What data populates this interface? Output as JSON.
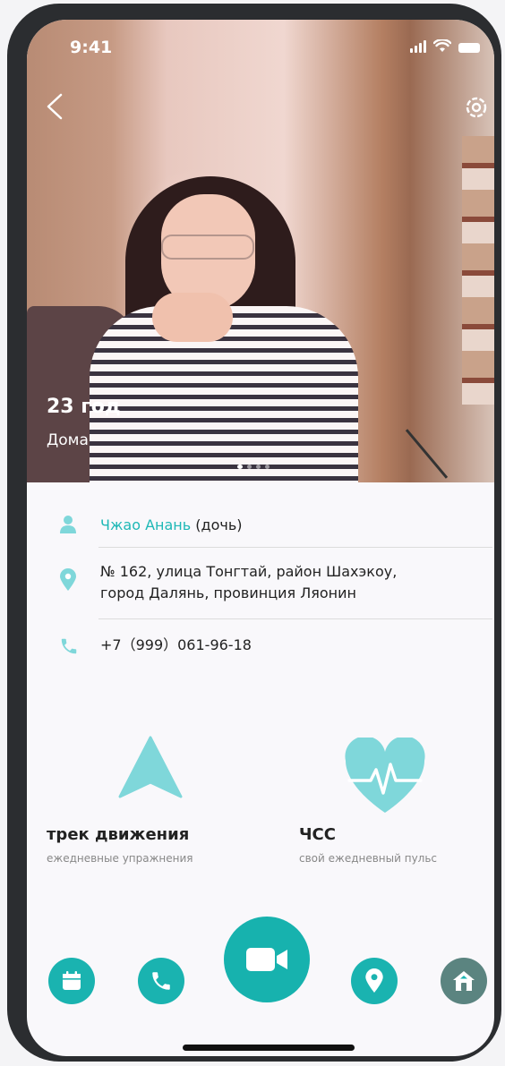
{
  "status_bar": {
    "time": "9:41"
  },
  "profile": {
    "age": "23 год",
    "status": "Дома"
  },
  "contact": {
    "name": "Чжао Анань",
    "relation": "(дочь)",
    "address_line1": "№ 162, улица Тонгтай, район Шахэкоу,",
    "address_line2": "город Далянь, провинция Ляонин",
    "phone": "+7（999）061-96-18"
  },
  "features": {
    "track": {
      "title": "трек движения",
      "subtitle": "ежедневные упражнения",
      "icon": "navigation-arrow-icon"
    },
    "heart": {
      "title": "ЧСС",
      "subtitle": "свой ежедневный пульс",
      "icon": "heart-pulse-icon"
    }
  },
  "nav": {
    "items": [
      "calendar-icon",
      "phone-icon",
      "video-camera-icon",
      "location-pin-icon",
      "home-icon"
    ]
  },
  "colors": {
    "accent": "#1ab3b0",
    "heart": "#7fd7da",
    "home_button": "#5b8480"
  },
  "carousel": {
    "count": 4,
    "active": 1
  }
}
